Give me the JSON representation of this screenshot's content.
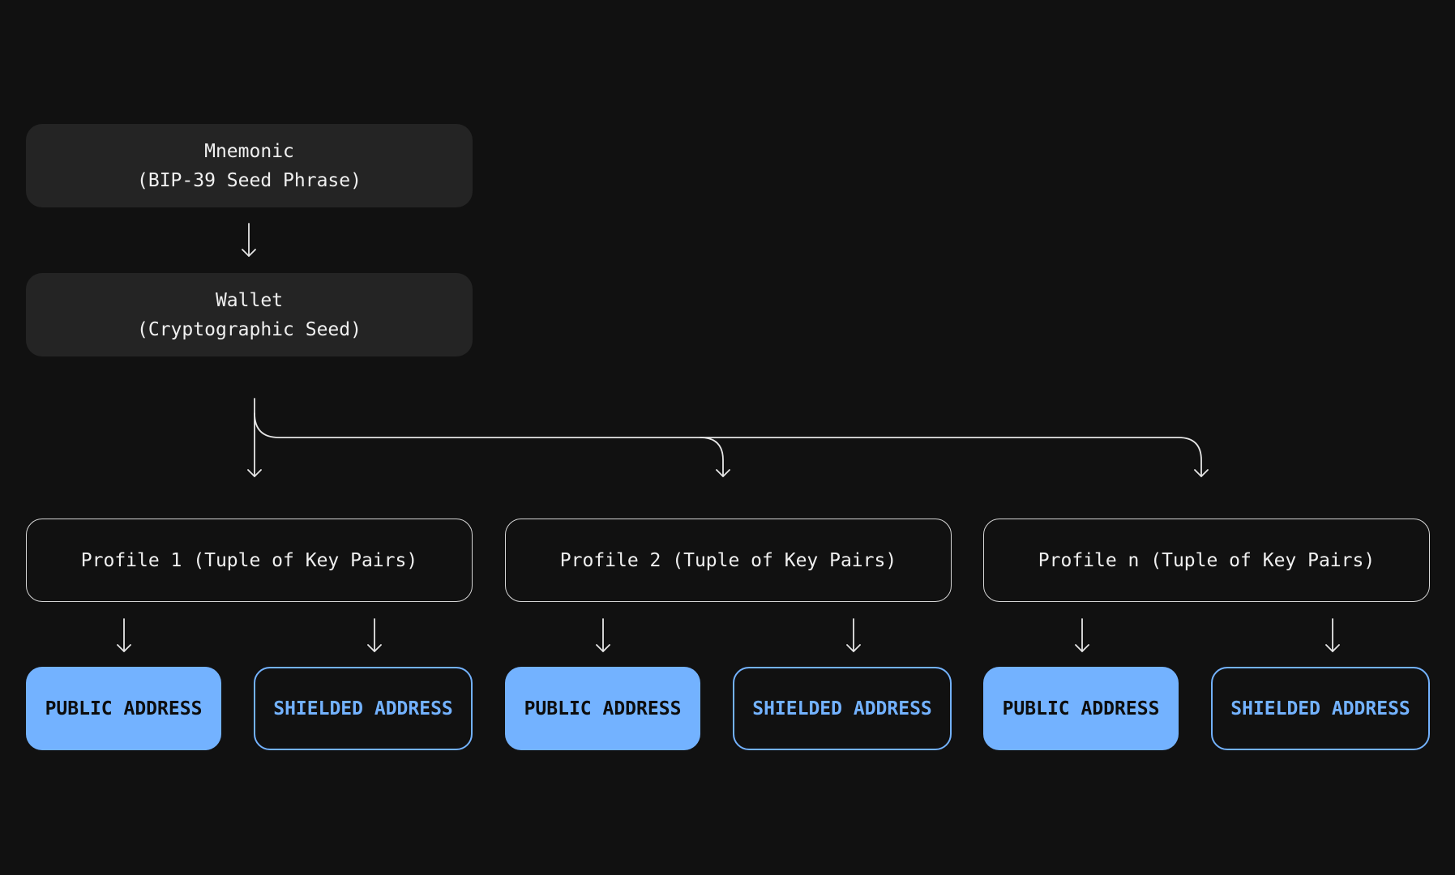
{
  "mnemonic": {
    "line1": "Mnemonic",
    "line2": "(BIP-39 Seed Phrase)"
  },
  "wallet": {
    "line1": "Wallet",
    "line2": "(Cryptographic Seed)"
  },
  "profiles": [
    {
      "label": "Profile 1 (Tuple of Key Pairs)",
      "public_label": "PUBLIC ADDRESS",
      "shielded_label": "SHIELDED ADDRESS"
    },
    {
      "label": "Profile 2 (Tuple of Key Pairs)",
      "public_label": "PUBLIC ADDRESS",
      "shielded_label": "SHIELDED ADDRESS"
    },
    {
      "label": "Profile n (Tuple of Key Pairs)",
      "public_label": "PUBLIC ADDRESS",
      "shielded_label": "SHIELDED ADDRESS"
    }
  ],
  "colors": {
    "background": "#111111",
    "node_fill": "#242424",
    "accent_blue": "#73b2ff",
    "line": "#e6e6e6"
  }
}
